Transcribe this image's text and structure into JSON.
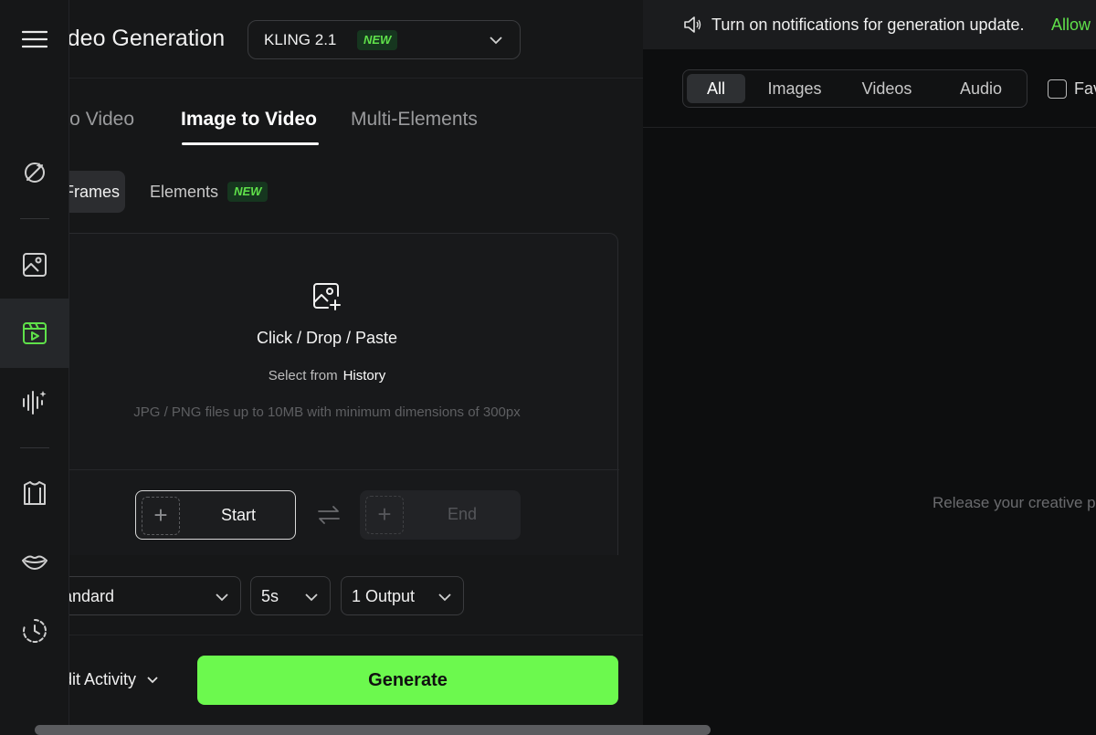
{
  "header": {
    "title": "Video Generation",
    "model": {
      "label": "KLING 2.1",
      "badge": "NEW"
    }
  },
  "mode_tabs": [
    {
      "label": "Text to Video"
    },
    {
      "label": "Image to Video",
      "active": true
    },
    {
      "label": "Multi-Elements"
    }
  ],
  "sub_tabs": {
    "frames": "Frames",
    "elements": "Elements",
    "elements_badge": "NEW"
  },
  "upload": {
    "title": "Click / Drop / Paste",
    "select_prefix": "Select from",
    "history_link": "History",
    "hint": "JPG / PNG files up to 10MB with minimum dimensions of 300px"
  },
  "frames": {
    "start": "Start",
    "end": "End"
  },
  "options": {
    "quality": "Standard",
    "duration": "5s",
    "outputs": "1 Output"
  },
  "footer": {
    "credit_activity": "Credit Activity",
    "generate": "Generate"
  },
  "notification": {
    "text": "Turn on notifications for generation update.",
    "allow": "Allow"
  },
  "filters": {
    "tabs": [
      "All",
      "Images",
      "Videos",
      "Audio"
    ],
    "active": "All",
    "favorites": "Favorites"
  },
  "empty_state": "Release your creative potential",
  "colors": {
    "accent": "#6cf94e",
    "accent_text": "#5fe04a",
    "badge_bg": "#16361f",
    "panel_bg": "#161718",
    "app_bg": "#0d0e0f"
  },
  "sidebar_icons": [
    "menu-icon",
    "magic-wand-icon",
    "image-icon",
    "video-icon",
    "audio-icon",
    "outfit-icon",
    "lips-icon",
    "history-icon"
  ]
}
